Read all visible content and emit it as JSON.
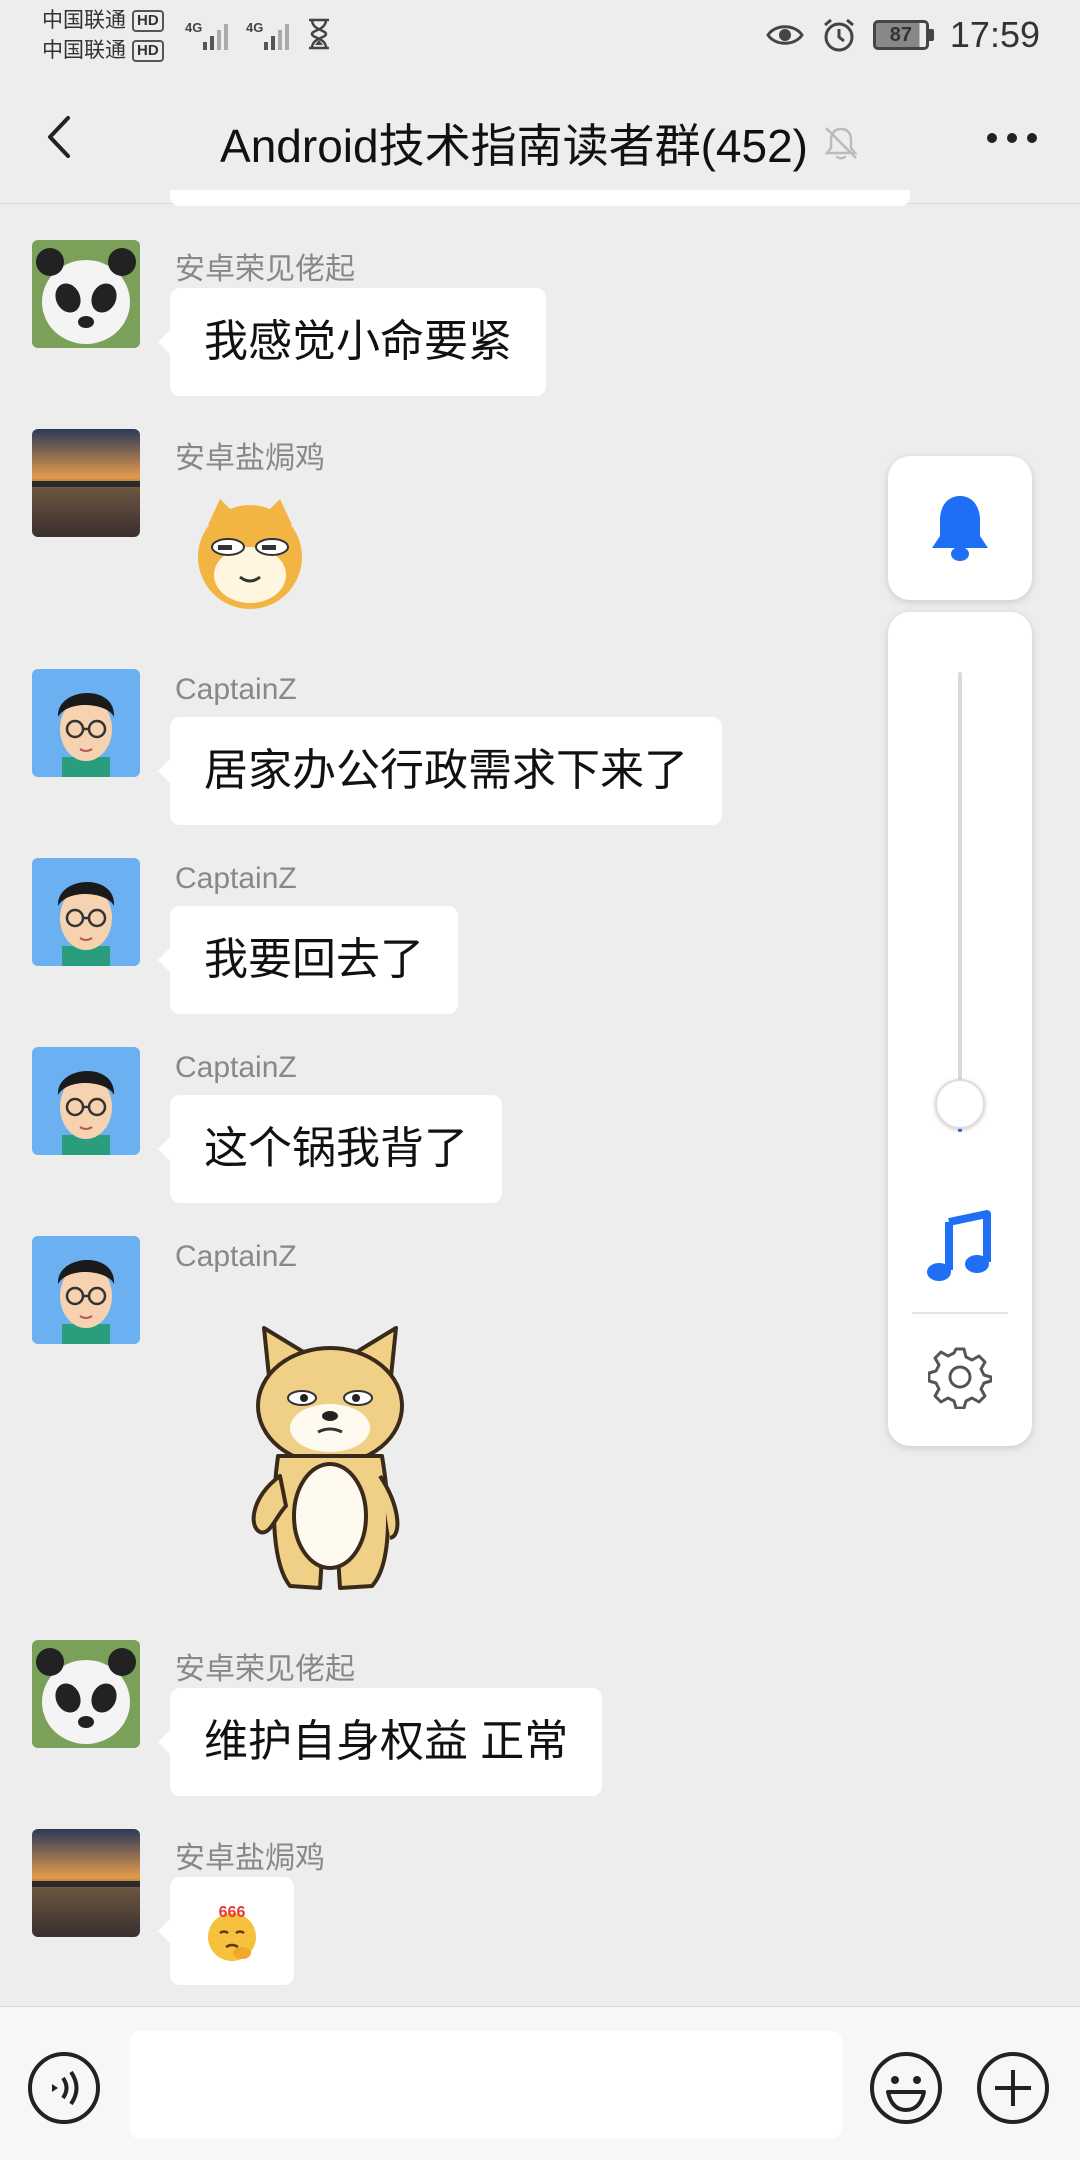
{
  "status_bar": {
    "carrier1": "中国联通",
    "carrier2": "中国联通",
    "hd_label": "HD",
    "network1": "4G",
    "network2": "4G",
    "battery": "87",
    "time": "17:59",
    "icons": [
      "eye-icon",
      "alarm-icon",
      "hourglass-icon"
    ]
  },
  "header": {
    "title": "Android技术指南读者群(452)",
    "icons": [
      "back-arrow-icon",
      "mute-bell-icon",
      "more-dots-icon"
    ]
  },
  "messages": [
    {
      "sender": "安卓荣见佬起",
      "avatar": "panda",
      "text": "我感觉小命要紧"
    },
    {
      "sender": "安卓盐焗鸡",
      "avatar": "sunset",
      "sticker": "smug-doge-emoji"
    },
    {
      "sender": "CaptainZ",
      "avatar": "cartoon-man",
      "text": "居家办公行政需求下来了"
    },
    {
      "sender": "CaptainZ",
      "avatar": "cartoon-man",
      "text": "我要回去了"
    },
    {
      "sender": "CaptainZ",
      "avatar": "cartoon-man",
      "text": "这个锅我背了"
    },
    {
      "sender": "CaptainZ",
      "avatar": "cartoon-man",
      "sticker": "standing-doge-sticker"
    },
    {
      "sender": "安卓荣见佬起",
      "avatar": "panda",
      "text": "维护自身权益 正常"
    },
    {
      "sender": "安卓盐焗鸡",
      "avatar": "sunset",
      "sticker": "666-thinking-emoji",
      "sticker_text": "666"
    }
  ],
  "volume_panel": {
    "level": 0.06,
    "accent": "#1e6ff5",
    "icons": [
      "bell-icon",
      "music-note-icon",
      "gear-icon"
    ]
  },
  "input_bar": {
    "placeholder": "",
    "icons": [
      "voice-icon",
      "emoji-icon",
      "plus-icon"
    ]
  }
}
